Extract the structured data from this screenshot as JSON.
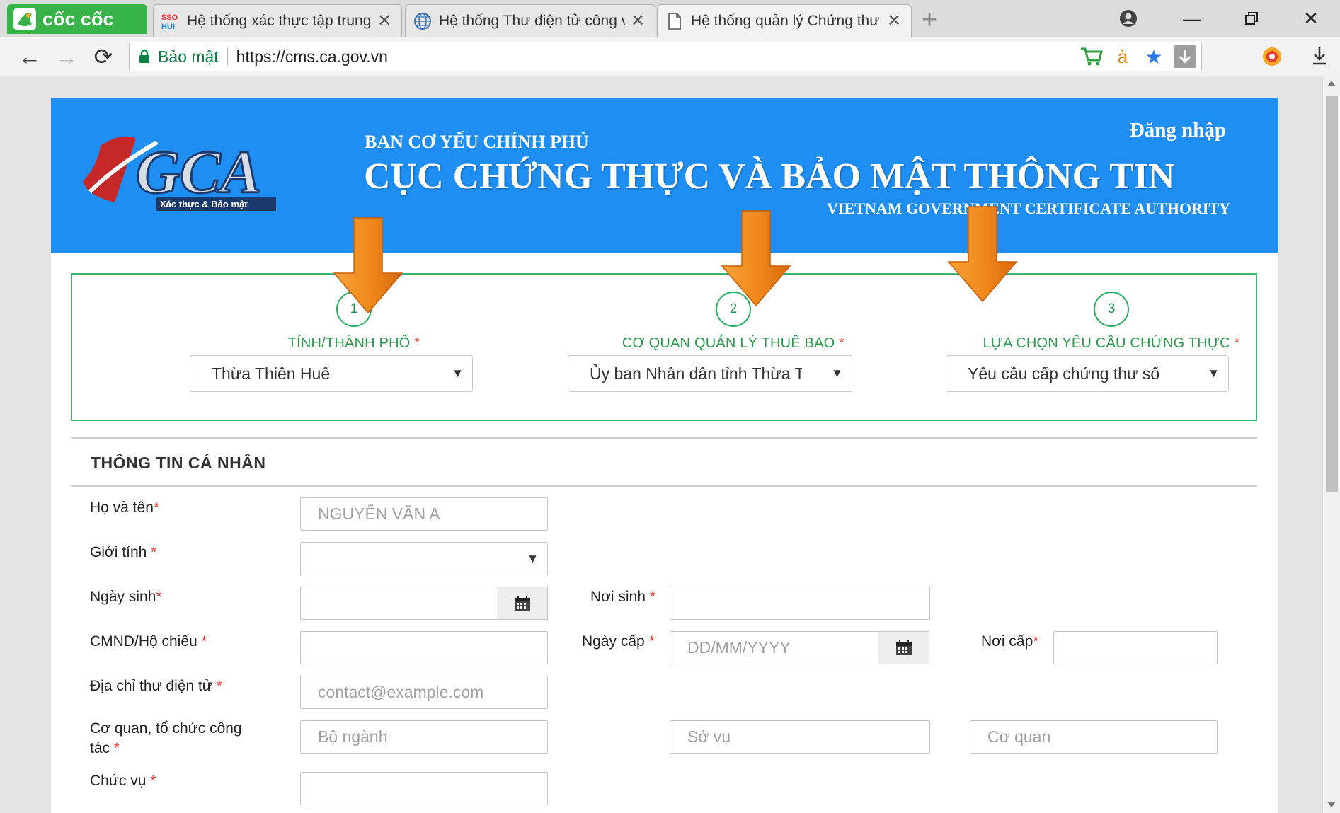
{
  "browser": {
    "brand": "cốc cốc",
    "tabs": [
      {
        "title": "Hệ thống xác thực tập trung",
        "icon": "sso-hui-icon",
        "active": false
      },
      {
        "title": "Hệ thống Thư điện tử công vụ",
        "icon": "globe-icon",
        "active": false
      },
      {
        "title": "Hệ thống quản lý Chứng thư",
        "icon": "page-icon",
        "active": true
      }
    ],
    "security_label": "Bảo mật",
    "url": "https://cms.ca.gov.vn"
  },
  "banner": {
    "small_title": "BAN CƠ YẾU CHÍNH PHỦ",
    "big_title": "CỤC CHỨNG THỰC VÀ BẢO MẬT THÔNG TIN",
    "en_title": "VIETNAM GOVERNMENT CERTIFICATE AUTHORITY",
    "login": "Đăng nhập",
    "logo_text": "VGCA",
    "logo_tagline": "Xác thực & Bảo mật"
  },
  "steps": [
    {
      "num": "1",
      "label": "TỈNH/THÀNH PHỐ",
      "required": "*",
      "value": "Thừa Thiên Huế"
    },
    {
      "num": "2",
      "label": "CƠ QUAN QUẢN LÝ THUÊ BAO",
      "required": "*",
      "value": "Ủy ban Nhân dân tỉnh Thừa Thiên Huế"
    },
    {
      "num": "3",
      "label": "LỰA CHỌN YÊU CẦU CHỨNG THỰC",
      "required": "*",
      "value": "Yêu cầu cấp chứng thư số"
    }
  ],
  "section": {
    "title": "THÔNG TIN CÁ NHÂN"
  },
  "form": {
    "fullname": {
      "label": "Họ và tên",
      "placeholder": "NGUYỄN VĂN A"
    },
    "gender": {
      "label": "Giới tính "
    },
    "dob": {
      "label": "Ngày sinh"
    },
    "birthplace": {
      "label": "Nơi sinh "
    },
    "id_number": {
      "label": "CMND/Hộ chiếu "
    },
    "issue_date": {
      "label": "Ngày cấp ",
      "placeholder": "DD/MM/YYYY"
    },
    "issue_place": {
      "label": "Nơi cấp"
    },
    "email": {
      "label": "Địa chỉ thư điện tử ",
      "placeholder": "contact@example.com"
    },
    "org": {
      "label_line1": "Cơ quan, tổ chức công",
      "label_line2": "tác ",
      "ministry_placeholder": "Bộ ngành",
      "dept_placeholder": "Sở vụ",
      "agency_placeholder": "Cơ quan"
    },
    "position": {
      "label": "Chức vụ "
    },
    "required_mark": "*"
  },
  "colors": {
    "banner": "#1e8ef2",
    "step_green": "#2b9a4e",
    "required": "#e53935",
    "arrow": "#f5861f"
  }
}
